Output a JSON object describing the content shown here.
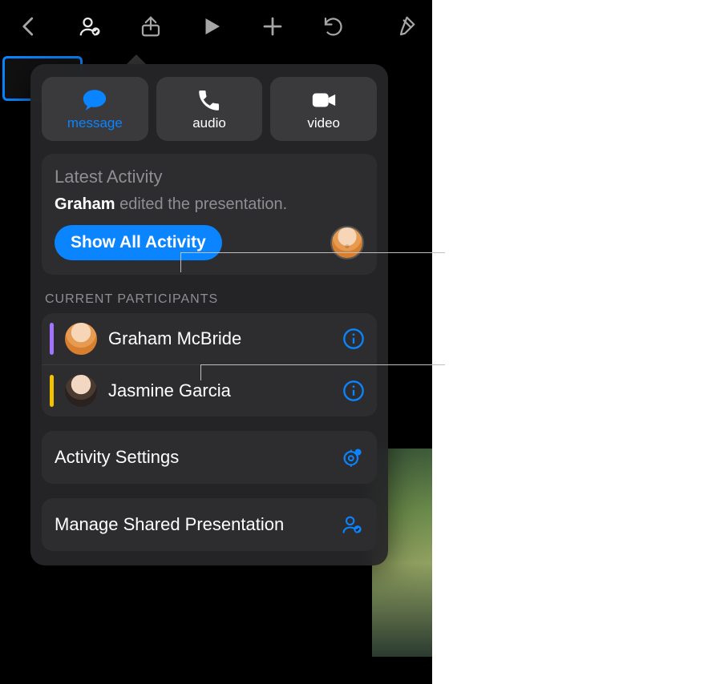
{
  "comm": {
    "message": "message",
    "audio": "audio",
    "video": "video"
  },
  "activity": {
    "title": "Latest Activity",
    "actor": "Graham",
    "action": " edited the presentation.",
    "show_all": "Show All Activity"
  },
  "participants": {
    "header": "CURRENT PARTICIPANTS",
    "items": [
      {
        "name": "Graham McBride",
        "stripe_color": "#a074ff"
      },
      {
        "name": "Jasmine Garcia",
        "stripe_color": "#f2c200"
      }
    ]
  },
  "options": {
    "activity_settings": "Activity Settings",
    "manage_shared": "Manage Shared Presentation"
  },
  "toolbar_icons": [
    "back-icon",
    "collaborate-icon",
    "share-icon",
    "play-icon",
    "add-icon",
    "undo-icon",
    "format-brush-icon"
  ],
  "colors": {
    "accent": "#0a84ff"
  }
}
